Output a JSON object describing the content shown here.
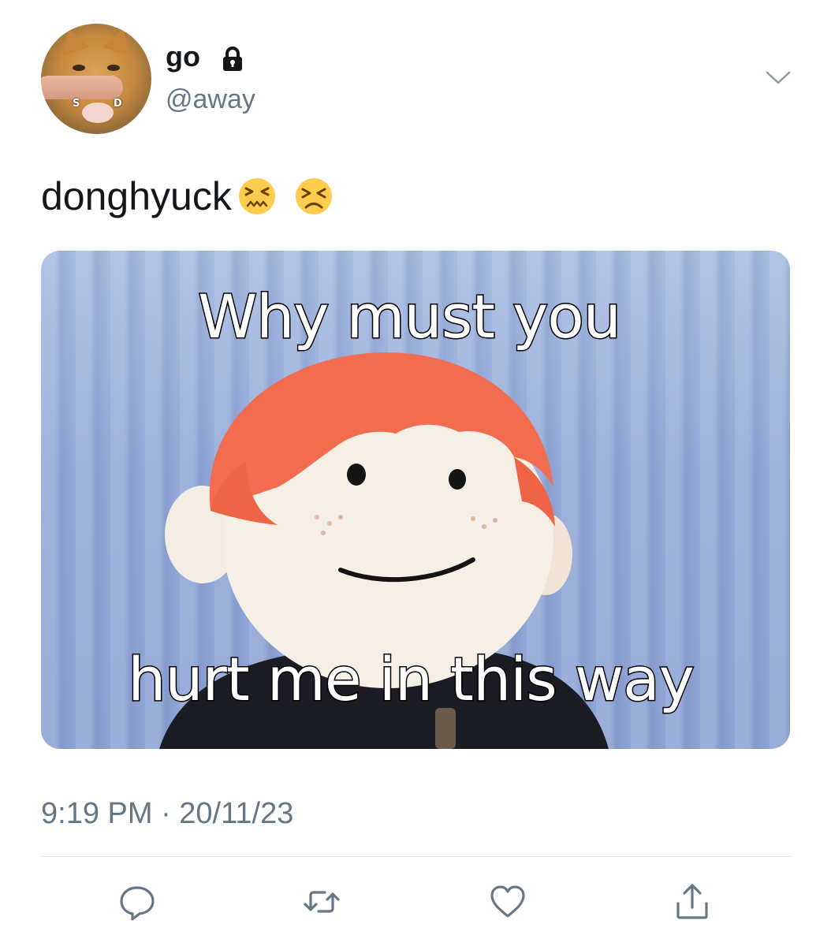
{
  "user": {
    "display_name": "go",
    "handle": "@away",
    "avatar_tags": [
      "S",
      "D"
    ],
    "lock_icon": "lock-icon"
  },
  "tweet": {
    "text": "donghyuck",
    "emojis": [
      "confounded-face-emoji",
      "persevering-face-emoji"
    ],
    "meme_caption_top": "Why must you",
    "meme_caption_bottom": "hurt me in this way",
    "timestamp": "9:19 PM · 20/11/23"
  },
  "actions": [
    {
      "name": "reply",
      "icon": "reply-icon"
    },
    {
      "name": "retweet",
      "icon": "retweet-icon"
    },
    {
      "name": "like",
      "icon": "heart-icon"
    },
    {
      "name": "share",
      "icon": "share-icon"
    }
  ],
  "colors": {
    "text_primary": "#14171a",
    "text_secondary": "#657786",
    "divider": "#e1e8ed"
  }
}
